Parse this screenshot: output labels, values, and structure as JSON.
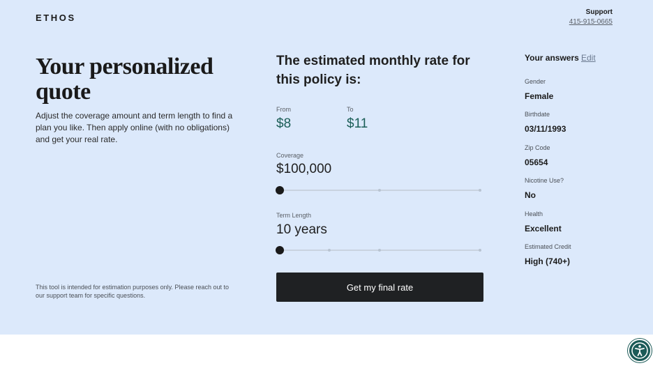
{
  "brand": {
    "logo": "ETHOS"
  },
  "support": {
    "label": "Support",
    "phone": "415-915-0665"
  },
  "intro": {
    "title": "Your personalized quote",
    "description": "Adjust the coverage amount and term length to find a plan you like. Then apply online (with no obligations) and get your real rate.",
    "disclaimer": "This tool is intended for estimation purposes only. Please reach out to our support team for specific questions."
  },
  "quote": {
    "title": "The estimated monthly rate for this policy is:",
    "from_label": "From",
    "from_value": "$8",
    "to_label": "To",
    "to_value": "$11",
    "coverage": {
      "label": "Coverage",
      "value": "$100,000",
      "slider_fraction": 0
    },
    "term": {
      "label": "Term Length",
      "value": "10 years",
      "slider_fraction": 0
    },
    "cta": "Get my final rate"
  },
  "answers": {
    "heading": "Your answers",
    "edit": "Edit",
    "items": [
      {
        "key": "Gender",
        "value": "Female"
      },
      {
        "key": "Birthdate",
        "value": "03/11/1993"
      },
      {
        "key": "Zip Code",
        "value": "05654"
      },
      {
        "key": "Nicotine Use?",
        "value": "No"
      },
      {
        "key": "Health",
        "value": "Excellent"
      },
      {
        "key": "Estimated Credit",
        "value": "High (740+)"
      }
    ]
  },
  "colors": {
    "background": "#dce9fb",
    "accent": "#1b5e57",
    "button": "#1f2123"
  },
  "icons": {
    "accessibility": "accessibility-icon"
  }
}
